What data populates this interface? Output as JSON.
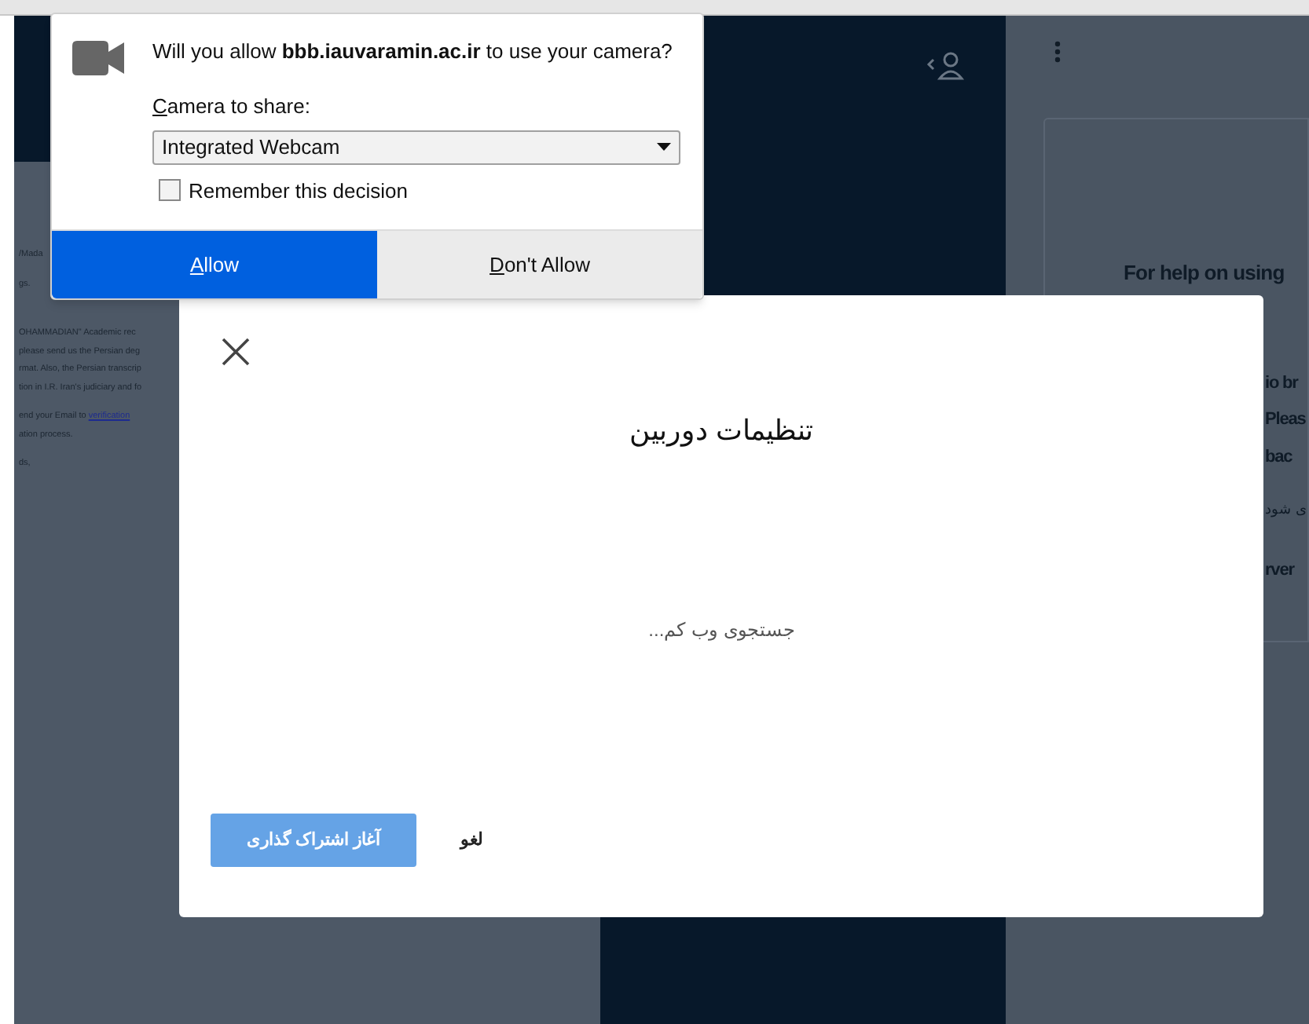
{
  "background": {
    "left_text": [
      {
        "text": "/Mada",
        "kind": "line"
      },
      {
        "text": "gs.",
        "kind": "para"
      },
      {
        "text": "OHAMMADIAN\"  Academic rec",
        "kind": "gap"
      },
      {
        "text": "please send us the Persian deg",
        "kind": "line"
      },
      {
        "text": "rmat. Also, the Persian transcrip",
        "kind": "line"
      },
      {
        "text": "tion in I.R. Iran's judiciary and fo",
        "kind": "line"
      },
      {
        "text": "end your Email to",
        "kind": "para",
        "link": "verification"
      },
      {
        "text": "ation process.",
        "kind": "line"
      },
      {
        "text": "ds,",
        "kind": "para"
      }
    ],
    "right_heading": "For help on using",
    "right_text": [
      {
        "text": "io br",
        "kind": "bold"
      },
      {
        "text": "Pleas",
        "kind": "bold"
      },
      {
        "text": "bac",
        "kind": "bold"
      },
      {
        "text": "ی شود",
        "kind": "plain"
      },
      {
        "text": "rver",
        "kind": "bold"
      }
    ]
  },
  "modal": {
    "title": "تنظیمات دوربین",
    "status": "جستجوی وب کم...",
    "buttons": [
      {
        "label": "لغو",
        "kind": "link"
      },
      {
        "label": "آغاز اشتراک گذاری",
        "kind": "primary"
      }
    ]
  },
  "popup": {
    "message": "Will you allow **bbb.iauvaramin.ac.ir** to use your camera?",
    "select_label": "Camera to share:",
    "select_value": "Integrated Webcam",
    "remember": {
      "label": "Remember this decision",
      "checked": false
    },
    "buttons": [
      {
        "label": "Allow",
        "primary": true
      },
      {
        "label": "Don't Allow",
        "primary": false
      }
    ]
  }
}
